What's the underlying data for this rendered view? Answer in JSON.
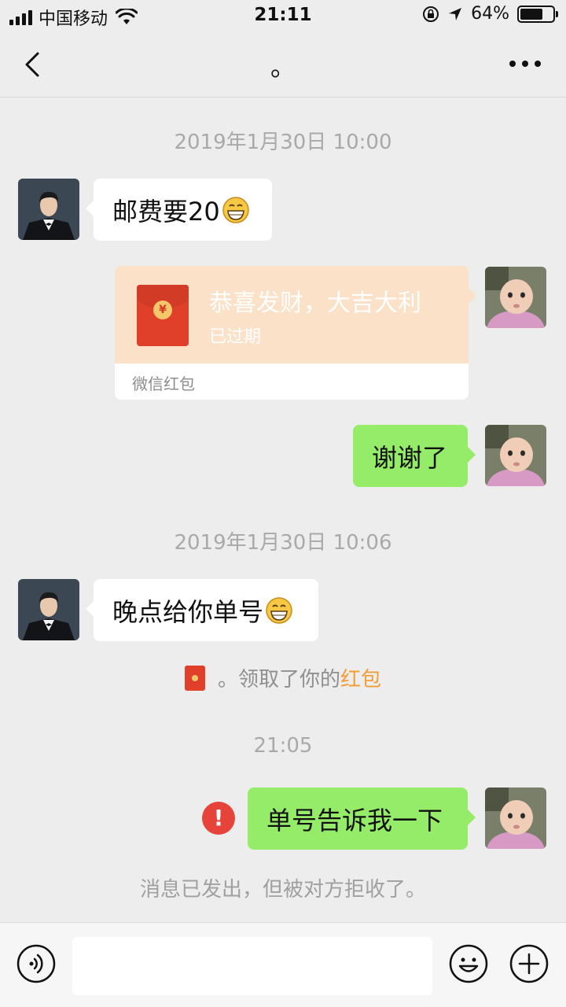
{
  "status_bar": {
    "carrier": "中国移动",
    "time": "21:11",
    "battery": "64%",
    "battery_level": 0.64
  },
  "nav": {
    "title": "。",
    "back_icon": "chevron-left-icon",
    "more_icon": "ellipsis-icon"
  },
  "messages": [
    {
      "type": "timestamp",
      "text": "2019年1月30日 10:00"
    },
    {
      "type": "incoming_text",
      "text": "邮费要20",
      "emoji": "grinning-face"
    },
    {
      "type": "outgoing_red_packet",
      "title": "恭喜发财，大吉大利",
      "status": "已过期",
      "footer": "微信红包",
      "currency_symbol": "¥"
    },
    {
      "type": "outgoing_text",
      "text": "谢谢了"
    },
    {
      "type": "timestamp",
      "text": "2019年1月30日 10:06"
    },
    {
      "type": "incoming_text",
      "text": "晚点给你单号",
      "emoji": "grinning-face"
    },
    {
      "type": "system_red_packet",
      "prefix": "。领取了你的",
      "link": "红包"
    },
    {
      "type": "timestamp",
      "text": "21:05"
    },
    {
      "type": "outgoing_text_failed",
      "text": "单号告诉我一下",
      "error_mark": "!"
    },
    {
      "type": "system_note",
      "text": "消息已发出，但被对方拒收了。"
    }
  ],
  "input_bar": {
    "voice_icon": "voice-icon",
    "emoji_icon": "smiley-icon",
    "plus_icon": "plus-circle-icon",
    "value": ""
  },
  "colors": {
    "background": "#ededed",
    "outgoing_bubble": "#95ec69",
    "red_packet": "#fbe1c8",
    "link": "#f29e38",
    "error": "#e6443b"
  }
}
